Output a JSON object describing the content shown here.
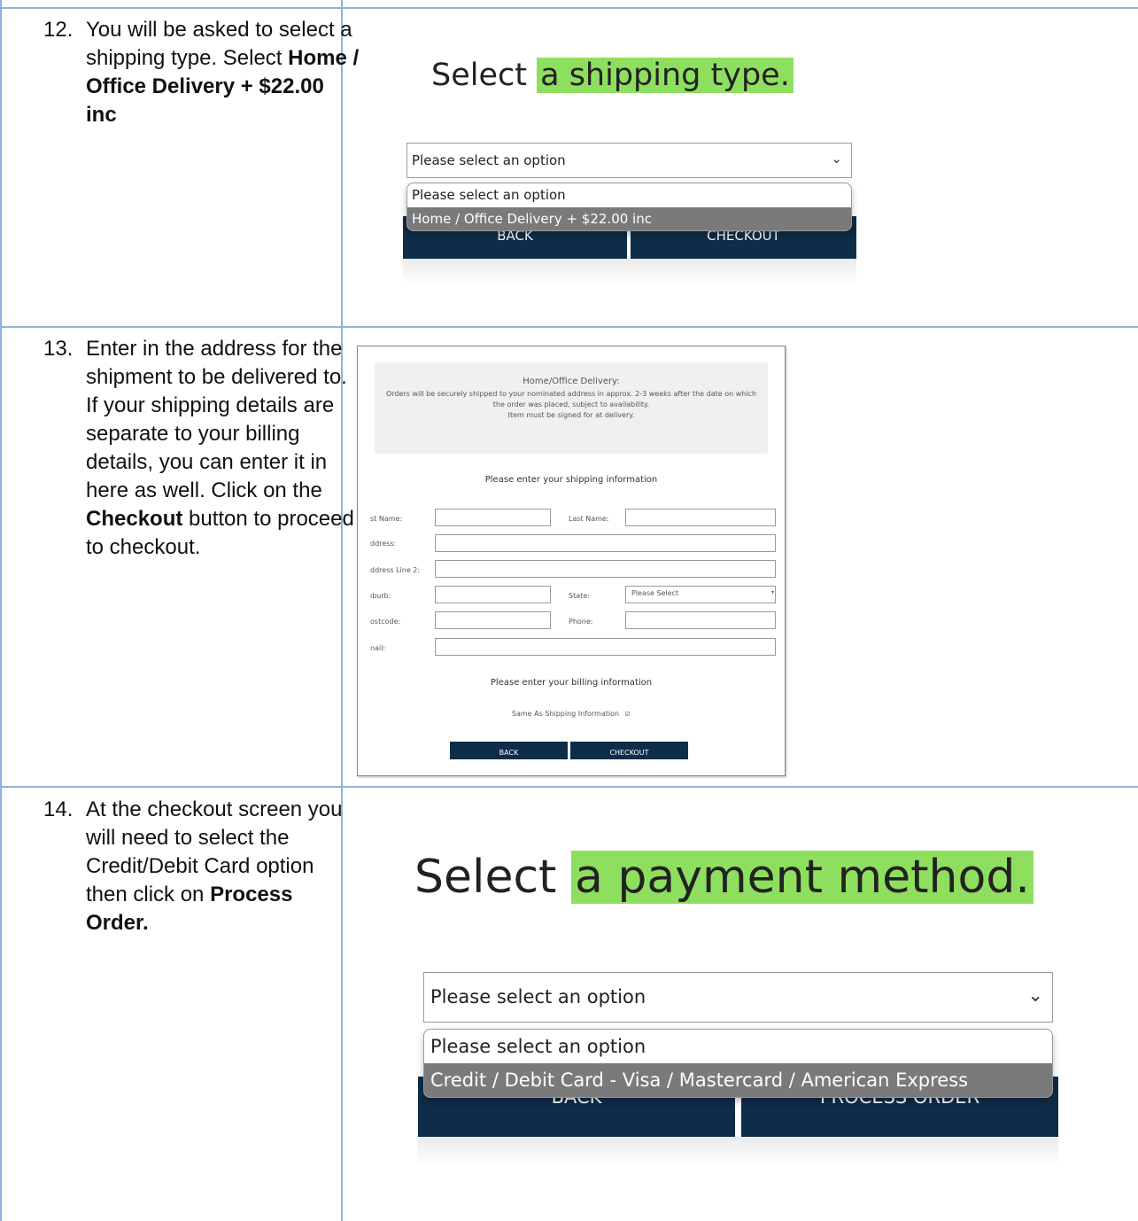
{
  "steps": [
    {
      "num": "12.",
      "pre": "You will be asked to select a shipping type. Select ",
      "bold": "Home / Office Delivery + $22.00 inc",
      "post": ""
    },
    {
      "num": "13.",
      "pre": "Enter in the address for the shipment to be delivered to. If your shipping details are separate to your billing details, you can enter it in here as well. Click on the ",
      "bold": "Checkout",
      "post": " button to proceed to checkout."
    },
    {
      "num": "14.",
      "pre": "At the checkout screen you will need to select the Credit/Debit Card option then click on ",
      "bold": "Process Order.",
      "post": ""
    }
  ],
  "shipping": {
    "heading_plain": "Select",
    "heading_highlight": "a shipping type.",
    "select_value": "Please select an option",
    "options": [
      "Please select an option",
      "Home / Office Delivery + $22.00 inc"
    ],
    "back_label": "BACK",
    "checkout_label": "CHECKOUT"
  },
  "address_form": {
    "info_title": "Home/Office Delivery:",
    "info_line1": "Orders will be securely shipped to your nominated address in approx. 2-3 weeks after the date on which",
    "info_line2": "the order was placed, subject to availability.",
    "info_line3": "Item must be signed for at delivery.",
    "shipping_heading": "Please enter your shipping information",
    "first_name_label": "st Name:",
    "last_name_label": "Last Name:",
    "address_label": "ddress:",
    "address2_label": "ddress Line 2:",
    "suburb_label": "ıburb:",
    "state_label": "State:",
    "state_value": "Please Select",
    "postcode_label": "ostcode:",
    "phone_label": "Phone:",
    "email_label": "nail:",
    "billing_heading": "Please enter your billing information",
    "same_as_label": "Same As Shipping Information",
    "back_label": "BACK",
    "checkout_label": "CHECKOUT"
  },
  "payment": {
    "heading_plain": "Select",
    "heading_highlight": "a payment method.",
    "select_value": "Please select an option",
    "options": [
      "Please select an option",
      "Credit / Debit Card - Visa / Mastercard / American Express"
    ],
    "back_label": "BACK",
    "process_label": "PROCESS ORDER"
  }
}
